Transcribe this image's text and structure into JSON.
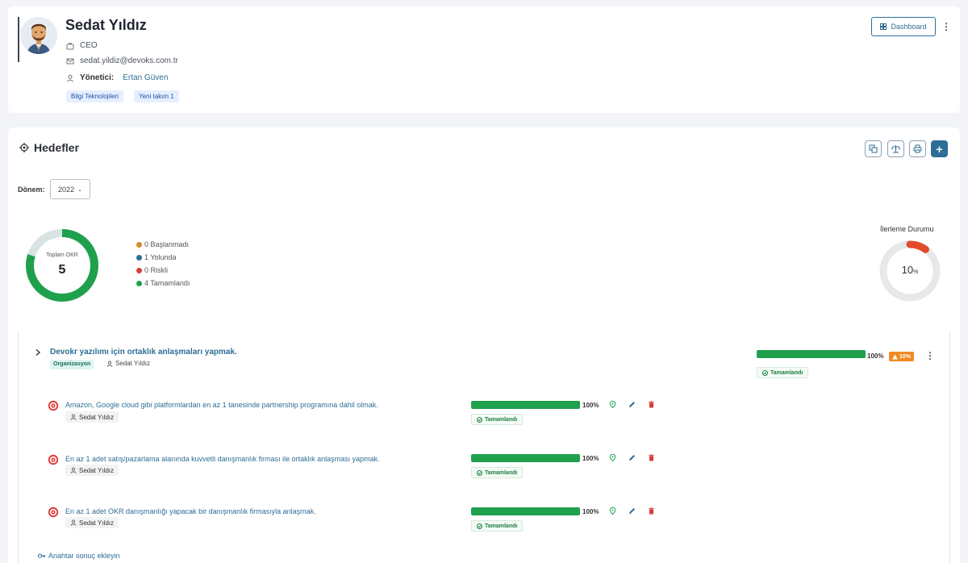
{
  "profile": {
    "name": "Sedat Yıldız",
    "role": "CEO",
    "email": "sedat.yildiz@devoks.com.tr",
    "manager_label": "Yönetici:",
    "manager_name": "Ertan Güven",
    "tags": [
      "Bilgi Teknolojileri",
      "Yeni takım 1"
    ],
    "dashboard_label": "Dashboard"
  },
  "okr": {
    "title": "Hedefler",
    "period_label": "Dönem:",
    "period_value": "2022",
    "summary": {
      "center_label": "Toplam OKR",
      "total": "5",
      "legend": [
        {
          "label": "0 Başlanmadı",
          "color": "#d98a2b",
          "count": 0
        },
        {
          "label": "1 Yolunda",
          "color": "#2a6d96",
          "count": 1
        },
        {
          "label": "0 Riskli",
          "color": "#d93b3b",
          "count": 0
        },
        {
          "label": "4 Tamamlandı",
          "color": "#1fa04d",
          "count": 4
        }
      ]
    },
    "progress": {
      "title": "İlerleme Durumu",
      "value": "10",
      "unit": "%",
      "fraction": 0.1
    },
    "objective": {
      "title": "Devokr yazılımı için ortaklık anlaşmaları yapmak.",
      "tag": "Organizasyon",
      "owner": "Sedat Yıldız",
      "percent_label": "100%",
      "progress": 1.0,
      "warning": "10%",
      "status": "Tamamlandı"
    },
    "key_results": [
      {
        "text": "Amazon, Google cloud gibi platformlardan en az 1 tanesinde partnership programına dahil olmak.",
        "owner": "Sedat Yıldız",
        "percent_label": "100%",
        "progress": 1.0,
        "status": "Tamamlandı"
      },
      {
        "text": "En az 1 adet satış/pazarlama alanında kuvvetli danışmanlık firması ile ortaklık anlaşması yapmak.",
        "owner": "Sedat Yıldız",
        "percent_label": "100%",
        "progress": 1.0,
        "status": "Tamamlandı"
      },
      {
        "text": "En az 1 adet OKR danışmanlığı yapacak bir danışmanlık firmasıyla anlaşmak.",
        "owner": "Sedat Yıldız",
        "percent_label": "100%",
        "progress": 1.0,
        "status": "Tamamlandı"
      }
    ],
    "add_kr_label": "Anahtar sonuç ekleyin"
  }
}
